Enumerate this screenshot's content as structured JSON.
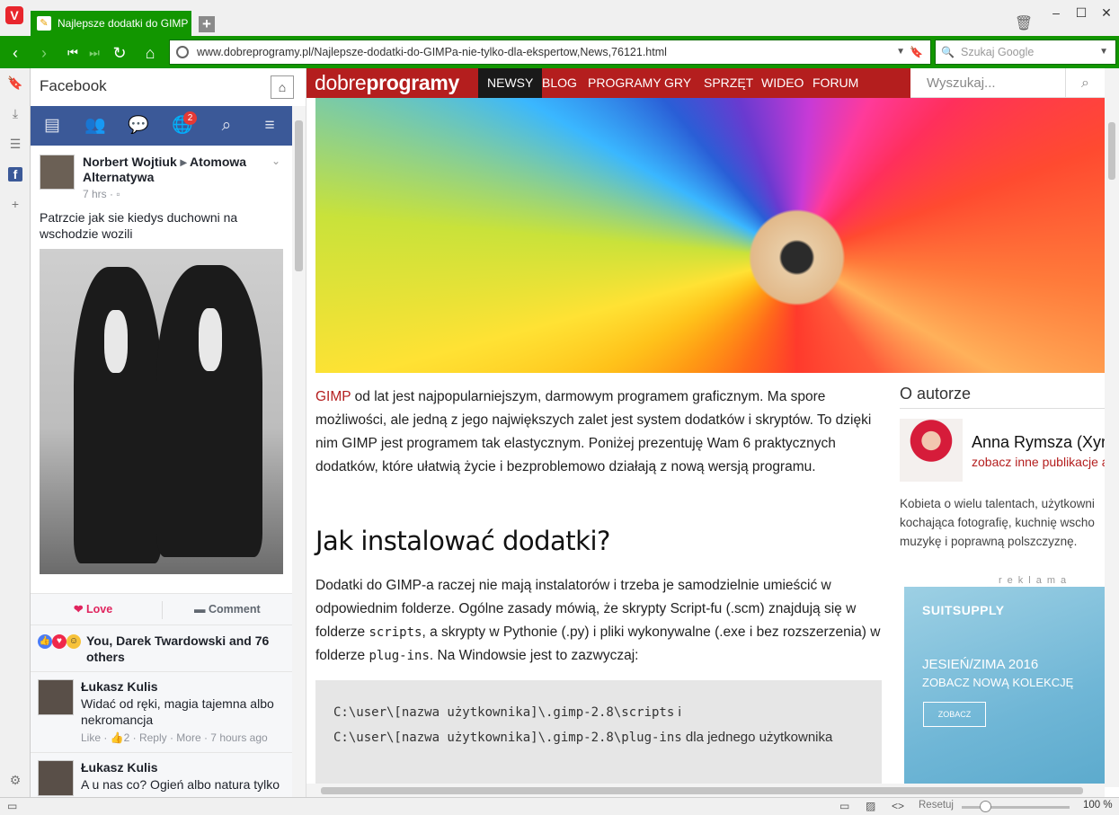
{
  "browser": {
    "tab_title": "Najlepsze dodatki do GIMP",
    "url": "www.dobreprogramy.pl/Najlepsze-dodatki-do-GIMPa-nie-tylko-dla-ekspertow,News,76121.html",
    "search_placeholder": "Szukaj Google",
    "accent": "#129600"
  },
  "panel": {
    "title": "Facebook",
    "notification_count": "2",
    "post": {
      "author": "Norbert Wojtiuk",
      "arrow": "▸",
      "target": "Atomowa Alternatywa",
      "time": "7 hrs · ",
      "text": "Patrzcie jak sie kiedys duchowni na wschodzie wozili"
    },
    "actions": {
      "love": "Love",
      "comment": "Comment"
    },
    "reactions": "You, Darek Twardowski and 76 others",
    "comments": [
      {
        "name": "Łukasz Kulis",
        "text": "Widać od ręki, magia tajemna albo nekromancja",
        "meta": "Like · 👍2 · Reply · More · 7 hours ago"
      },
      {
        "name": "Łukasz Kulis",
        "text": "A u nas co? Ogień albo natura tylko",
        "meta": ""
      }
    ]
  },
  "site": {
    "logo_light": "dobre",
    "logo_bold": "programy",
    "brand_color": "#b41e1e",
    "nav": [
      "NEWSY",
      "BLOG",
      "PROGRAMY",
      "GRY",
      "SPRZĘT",
      "WIDEO",
      "FORUM"
    ],
    "search_placeholder": "Wyszukaj...",
    "article": {
      "link": "GIMP",
      "p1": " od lat jest najpopularniejszym, darmowym programem graficznym. Ma spore możliwości, ale jedną z jego największych zalet jest system dodatków i skryptów. To dzięki nim GIMP jest programem tak elastycznym. Poniżej prezentuję Wam 6 praktycznych dodatków, które ułatwią życie i bezproblemowo działają z nową wersją programu.",
      "h2": "Jak instalować dodatki?",
      "p2a": "Dodatki do GIMP-a raczej nie mają instalatorów i trzeba je samodzielnie umieścić w odpowiednim folderze. Ogólne zasady mówią, że skrypty Script-fu (.scm) znajdują się w folderze ",
      "p2_code1": "scripts",
      "p2b": ", a skrypty w Pythonie (.py) i pliki wykonywalne (.exe i bez rozszerzenia) w folderze ",
      "p2_code2": "plug-ins",
      "p2c": ". Na Windowsie jest to zazwyczaj:",
      "code1": "C:\\user\\[nazwa użytkownika]\\.gimp-2.8\\scripts",
      "code1_after": " i",
      "code2": "C:\\user\\[nazwa użytkownika]\\.gimp-2.8\\plug-ins",
      "code2_after": " dla jednego użytkownika"
    },
    "aside": {
      "title": "O autorze",
      "author": "Anna Rymsza (Xyro",
      "author_link": "zobacz inne publikacje a",
      "bio": "Kobieta o wielu talentach, użytkowni kochająca fotografię, kuchnię wscho muzykę i poprawną polszczyznę."
    },
    "ad": {
      "label": "reklama",
      "brand": "SUITSUPPLY",
      "line1": "JESIEŃ/ZIMA 2016",
      "line2": "ZOBACZ NOWĄ KOLEKCJĘ",
      "button": "ZOBACZ"
    }
  },
  "status": {
    "reset": "Resetuj",
    "zoom": "100 %",
    "zoom_level": 100
  }
}
